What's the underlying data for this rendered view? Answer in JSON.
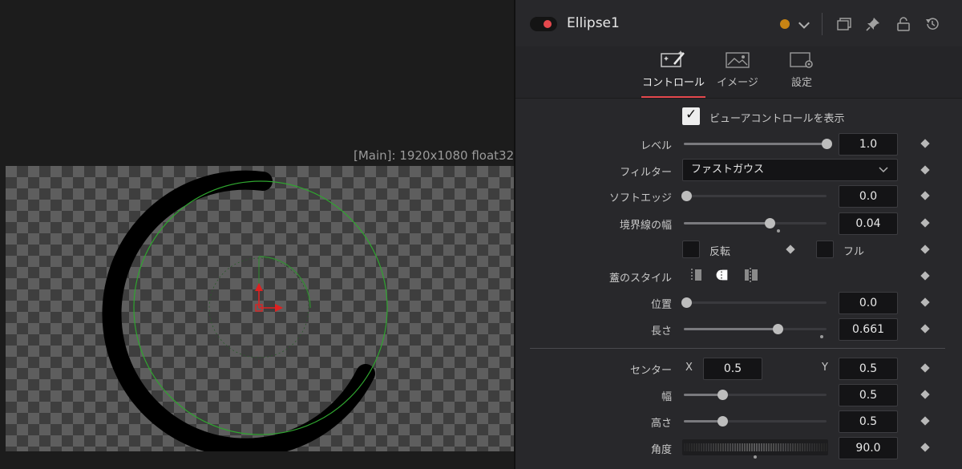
{
  "viewer": {
    "resolution_label": "[Main]: 1920x1080 float32"
  },
  "inspector": {
    "title": "Ellipse1",
    "tool_color": "#c78414",
    "enabled_color": "#e5484d",
    "accent_color": "#e5484d",
    "header_icons": [
      "chevron-down-icon",
      "version-icon",
      "pin-icon",
      "lock-icon",
      "reset-icon"
    ],
    "tabs": [
      {
        "label": "コントロール",
        "icon": "magic-wand-icon",
        "active": true
      },
      {
        "label": "イメージ",
        "icon": "image-icon",
        "active": false
      },
      {
        "label": "設定",
        "icon": "settings-icon",
        "active": false
      }
    ],
    "show_view_controls": {
      "label": "ビューアコントロールを表示",
      "checked": true
    },
    "level": {
      "label": "レベル",
      "value": "1.0",
      "fraction": 1.0
    },
    "filter": {
      "label": "フィルター",
      "value": "ファストガウス"
    },
    "soft_edge": {
      "label": "ソフトエッジ",
      "value": "0.0",
      "fraction": 0.0
    },
    "border_width": {
      "label": "境界線の幅",
      "value": "0.04",
      "fraction": 0.6
    },
    "invert": {
      "label": "反転",
      "checked": false
    },
    "solid": {
      "label": "フル",
      "checked": false
    },
    "cap_style": {
      "label": "蓋のスタイル",
      "options": [
        "flat-cap-icon",
        "round-cap-icon",
        "square-cap-icon"
      ],
      "selected": 1
    },
    "position": {
      "label": "位置",
      "value": "0.0",
      "fraction": 0.0
    },
    "length": {
      "label": "長さ",
      "value": "0.661",
      "fraction": 0.661
    },
    "center": {
      "label": "センター",
      "x_label": "X",
      "x": "0.5",
      "y_label": "Y",
      "y": "0.5"
    },
    "width": {
      "label": "幅",
      "value": "0.5",
      "fraction": 0.27
    },
    "height": {
      "label": "高さ",
      "value": "0.5",
      "fraction": 0.27
    },
    "angle": {
      "label": "角度",
      "value": "90.0"
    }
  }
}
